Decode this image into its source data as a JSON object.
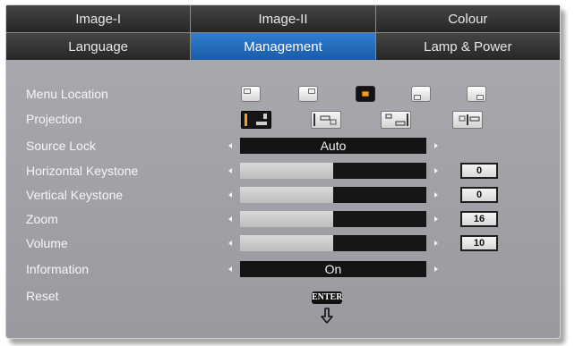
{
  "tabs_row1": [
    "Image-I",
    "Image-II",
    "Colour"
  ],
  "tabs_row2": [
    "Language",
    "Management",
    "Lamp & Power"
  ],
  "active_tab": "Management",
  "menu": {
    "menu_location": {
      "label": "Menu Location",
      "selected_index": 2,
      "options_count": 5
    },
    "projection": {
      "label": "Projection",
      "selected_index": 0,
      "options_count": 4
    },
    "source_lock": {
      "label": "Source Lock",
      "value": "Auto"
    },
    "horizontal_keystone": {
      "label": "Horizontal Keystone",
      "value": "0",
      "level": 0.5
    },
    "vertical_keystone": {
      "label": "Vertical Keystone",
      "value": "0",
      "level": 0.5
    },
    "zoom": {
      "label": "Zoom",
      "value": "16",
      "level": 0.5
    },
    "volume": {
      "label": "Volume",
      "value": "10",
      "level": 0.5
    },
    "information": {
      "label": "Information",
      "value": "On"
    },
    "reset": {
      "label": "Reset",
      "button": "ENTER"
    }
  },
  "colors": {
    "panel": "#a3a5aa",
    "tab_bg": "#333333",
    "tab_active": "#2470c0",
    "bar_dark": "#141414",
    "bar_fill": "#cfcfcf"
  },
  "icons": {
    "down": "down-arrow-icon"
  }
}
